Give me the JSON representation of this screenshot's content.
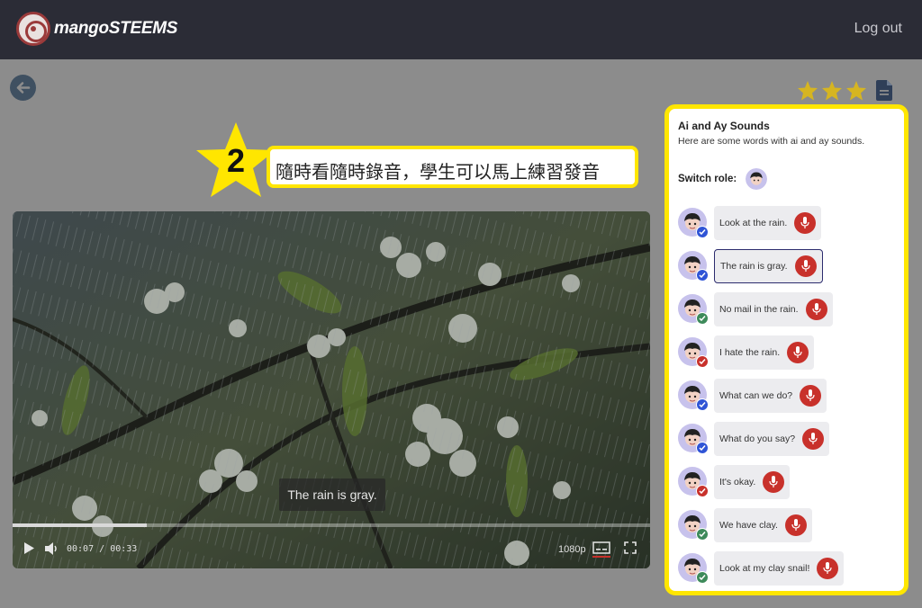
{
  "app": {
    "logo_text": "mangoSTEEMS",
    "logout_label": "Log out"
  },
  "rating": {
    "stars": 3,
    "icon": "star-icon",
    "color": "#d6b521"
  },
  "annotation": {
    "number": "2",
    "text": "隨時看隨時錄音，學生可以馬上練習發音"
  },
  "video": {
    "caption": "The rain is gray.",
    "current_time": "00:07",
    "duration": "00:33",
    "time_separator": "/",
    "quality": "1080p",
    "progress": 0.21
  },
  "panel": {
    "title": "Ai and Ay Sounds",
    "subtitle": "Here are some words with ai and ay sounds.",
    "switch_role_label": "Switch role:",
    "lines": [
      {
        "text": "Look at the rain.",
        "status": "blue-check",
        "active": false
      },
      {
        "text": "The rain is gray.",
        "status": "blue-check",
        "active": true
      },
      {
        "text": "No mail in the rain.",
        "status": "green-check",
        "active": false
      },
      {
        "text": "I hate the rain.",
        "status": "red-check",
        "active": false
      },
      {
        "text": "What can we do?",
        "status": "blue-check",
        "active": false
      },
      {
        "text": "What do you say?",
        "status": "blue-check",
        "active": false
      },
      {
        "text": "It's okay.",
        "status": "red-check",
        "active": false
      },
      {
        "text": "We have clay.",
        "status": "green-check",
        "active": false
      },
      {
        "text": "Look at my clay snail!",
        "status": "green-check",
        "active": false
      }
    ]
  },
  "colors": {
    "topbar": "#2b2c36",
    "highlight": "#ffe600",
    "mic": "#c8312b",
    "badge_blue": "#2f54d6",
    "badge_green": "#3d8a5a",
    "badge_red": "#c8312b"
  }
}
